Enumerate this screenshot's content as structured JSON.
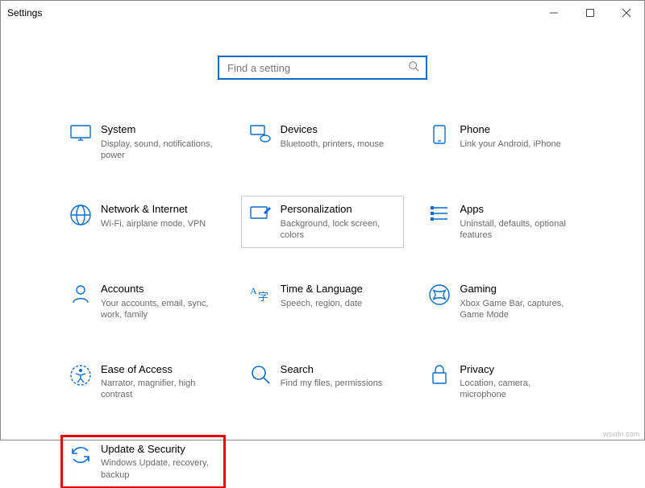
{
  "window": {
    "title": "Settings"
  },
  "search": {
    "placeholder": "Find a setting"
  },
  "tiles": {
    "system": {
      "label": "System",
      "desc": "Display, sound, notifications, power"
    },
    "devices": {
      "label": "Devices",
      "desc": "Bluetooth, printers, mouse"
    },
    "phone": {
      "label": "Phone",
      "desc": "Link your Android, iPhone"
    },
    "network": {
      "label": "Network & Internet",
      "desc": "Wi-Fi, airplane mode, VPN"
    },
    "personalization": {
      "label": "Personalization",
      "desc": "Background, lock screen, colors"
    },
    "apps": {
      "label": "Apps",
      "desc": "Uninstall, defaults, optional features"
    },
    "accounts": {
      "label": "Accounts",
      "desc": "Your accounts, email, sync, work, family"
    },
    "time": {
      "label": "Time & Language",
      "desc": "Speech, region, date"
    },
    "gaming": {
      "label": "Gaming",
      "desc": "Xbox Game Bar, captures, Game Mode"
    },
    "ease": {
      "label": "Ease of Access",
      "desc": "Narrator, magnifier, high contrast"
    },
    "search_tile": {
      "label": "Search",
      "desc": "Find my files, permissions"
    },
    "privacy": {
      "label": "Privacy",
      "desc": "Location, camera, microphone"
    },
    "update": {
      "label": "Update & Security",
      "desc": "Windows Update, recovery, backup"
    }
  },
  "watermark": "wsxdn.com"
}
